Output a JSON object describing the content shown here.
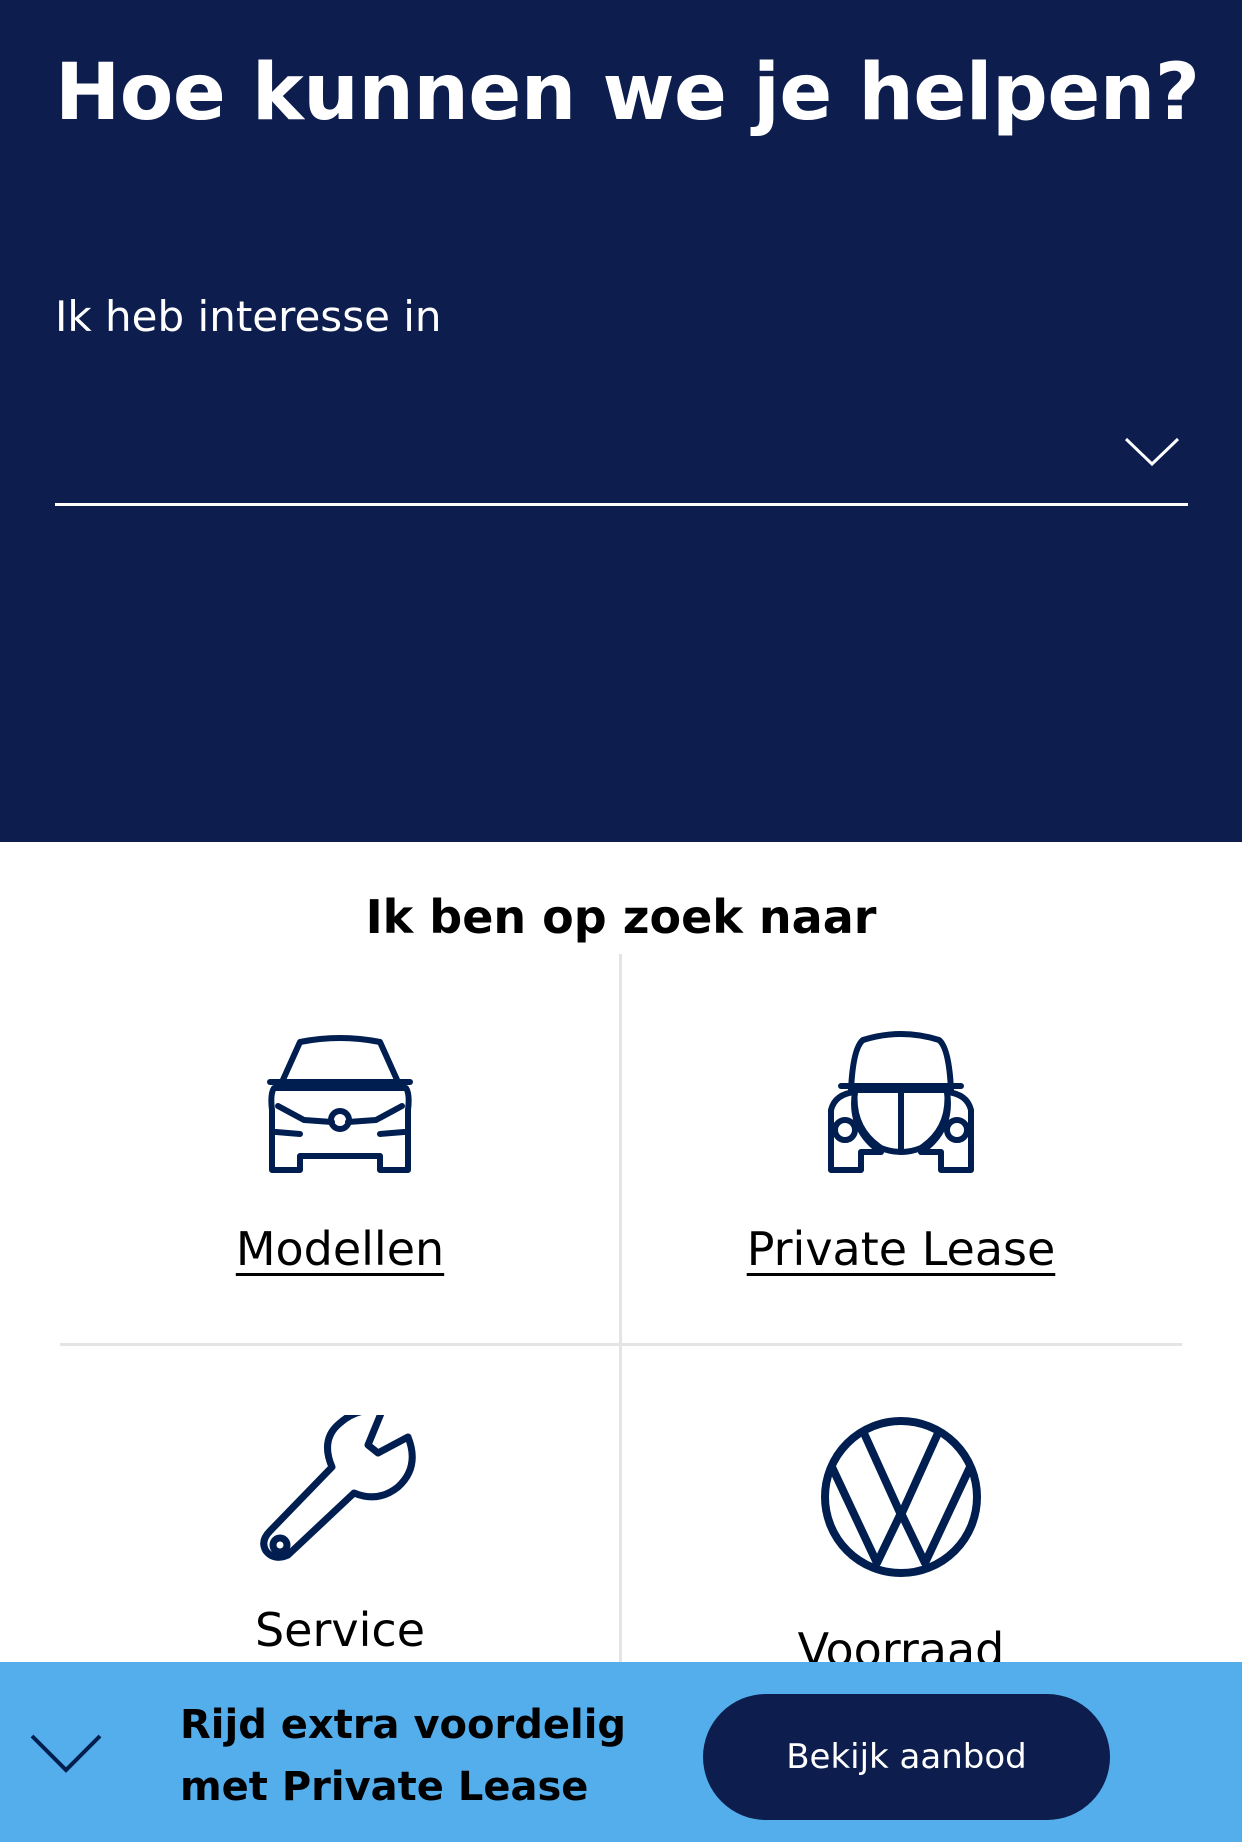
{
  "hero": {
    "title": "Hoe kunnen we je helpen?",
    "interest_label": "Ik heb interesse in",
    "interest_value": "",
    "icon": "chevron-down-icon"
  },
  "section": {
    "title": "Ik ben op zoek naar",
    "tiles": [
      {
        "label": "Modellen",
        "icon": "car-front-icon"
      },
      {
        "label": "Private Lease",
        "icon": "beetle-car-icon"
      },
      {
        "label": "Service",
        "icon": "wrench-icon"
      },
      {
        "label": "Voorraad",
        "icon": "vw-logo-icon"
      }
    ]
  },
  "promo": {
    "text_line1": "Rijd extra voordelig",
    "text_line2": "met Private Lease",
    "button_label": "Bekijk aanbod",
    "icon": "chevron-down-icon"
  },
  "colors": {
    "hero_background": "#0c1d4e",
    "promo_background": "#53aeeb",
    "icon_color": "#001e50",
    "divider": "#e3e4e6"
  }
}
